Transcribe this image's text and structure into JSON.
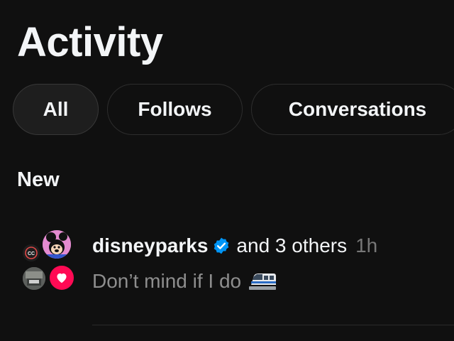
{
  "header": {
    "title": "Activity"
  },
  "filters": {
    "tabs": [
      {
        "label": "All",
        "active": true
      },
      {
        "label": "Follows",
        "active": false
      },
      {
        "label": "Conversations",
        "active": false
      }
    ]
  },
  "sections": {
    "new": {
      "heading": "New",
      "notifications": [
        {
          "username": "disneyparks",
          "verified": true,
          "others_text": "and 3 others",
          "time": "1h",
          "comment": "Don’t mind if I do",
          "comment_emoji": "monorail-icon",
          "badge": "heart-icon",
          "avatars": [
            "cc-avatar",
            "disney-avatar",
            "garage-avatar"
          ]
        }
      ]
    }
  },
  "colors": {
    "background": "#101010",
    "text": "#f3f5f7",
    "muted": "#8e8e8e",
    "verified": "#0095f6",
    "heart": "#ff0a54"
  }
}
